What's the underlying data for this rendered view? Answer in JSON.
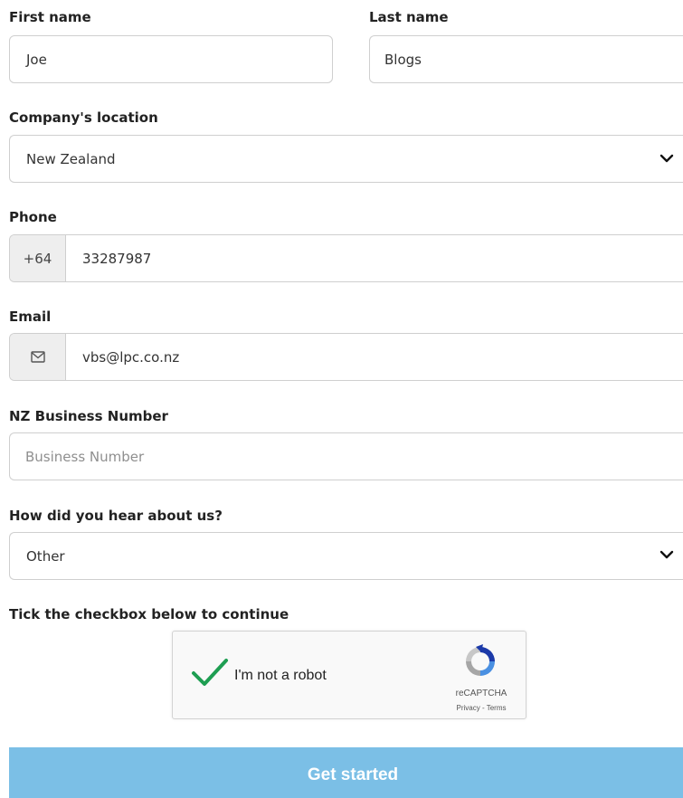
{
  "first_name": {
    "label": "First name",
    "value": "Joe"
  },
  "last_name": {
    "label": "Last name",
    "value": "Blogs"
  },
  "location": {
    "label": "Company's location",
    "value": "New Zealand"
  },
  "phone": {
    "label": "Phone",
    "prefix": "+64",
    "value": "33287987"
  },
  "email": {
    "label": "Email",
    "value": "vbs@lpc.co.nz"
  },
  "business_number": {
    "label": "NZ Business Number",
    "placeholder": "Business Number"
  },
  "referral": {
    "label": "How did you hear about us?",
    "value": "Other"
  },
  "captcha": {
    "instruction": "Tick the checkbox below to continue",
    "label": "I'm not a robot",
    "brand": "reCAPTCHA",
    "links": "Privacy - Terms"
  },
  "submit": {
    "label": "Get started"
  },
  "colors": {
    "button": "#7bbfe6",
    "check": "#1e9e52"
  }
}
